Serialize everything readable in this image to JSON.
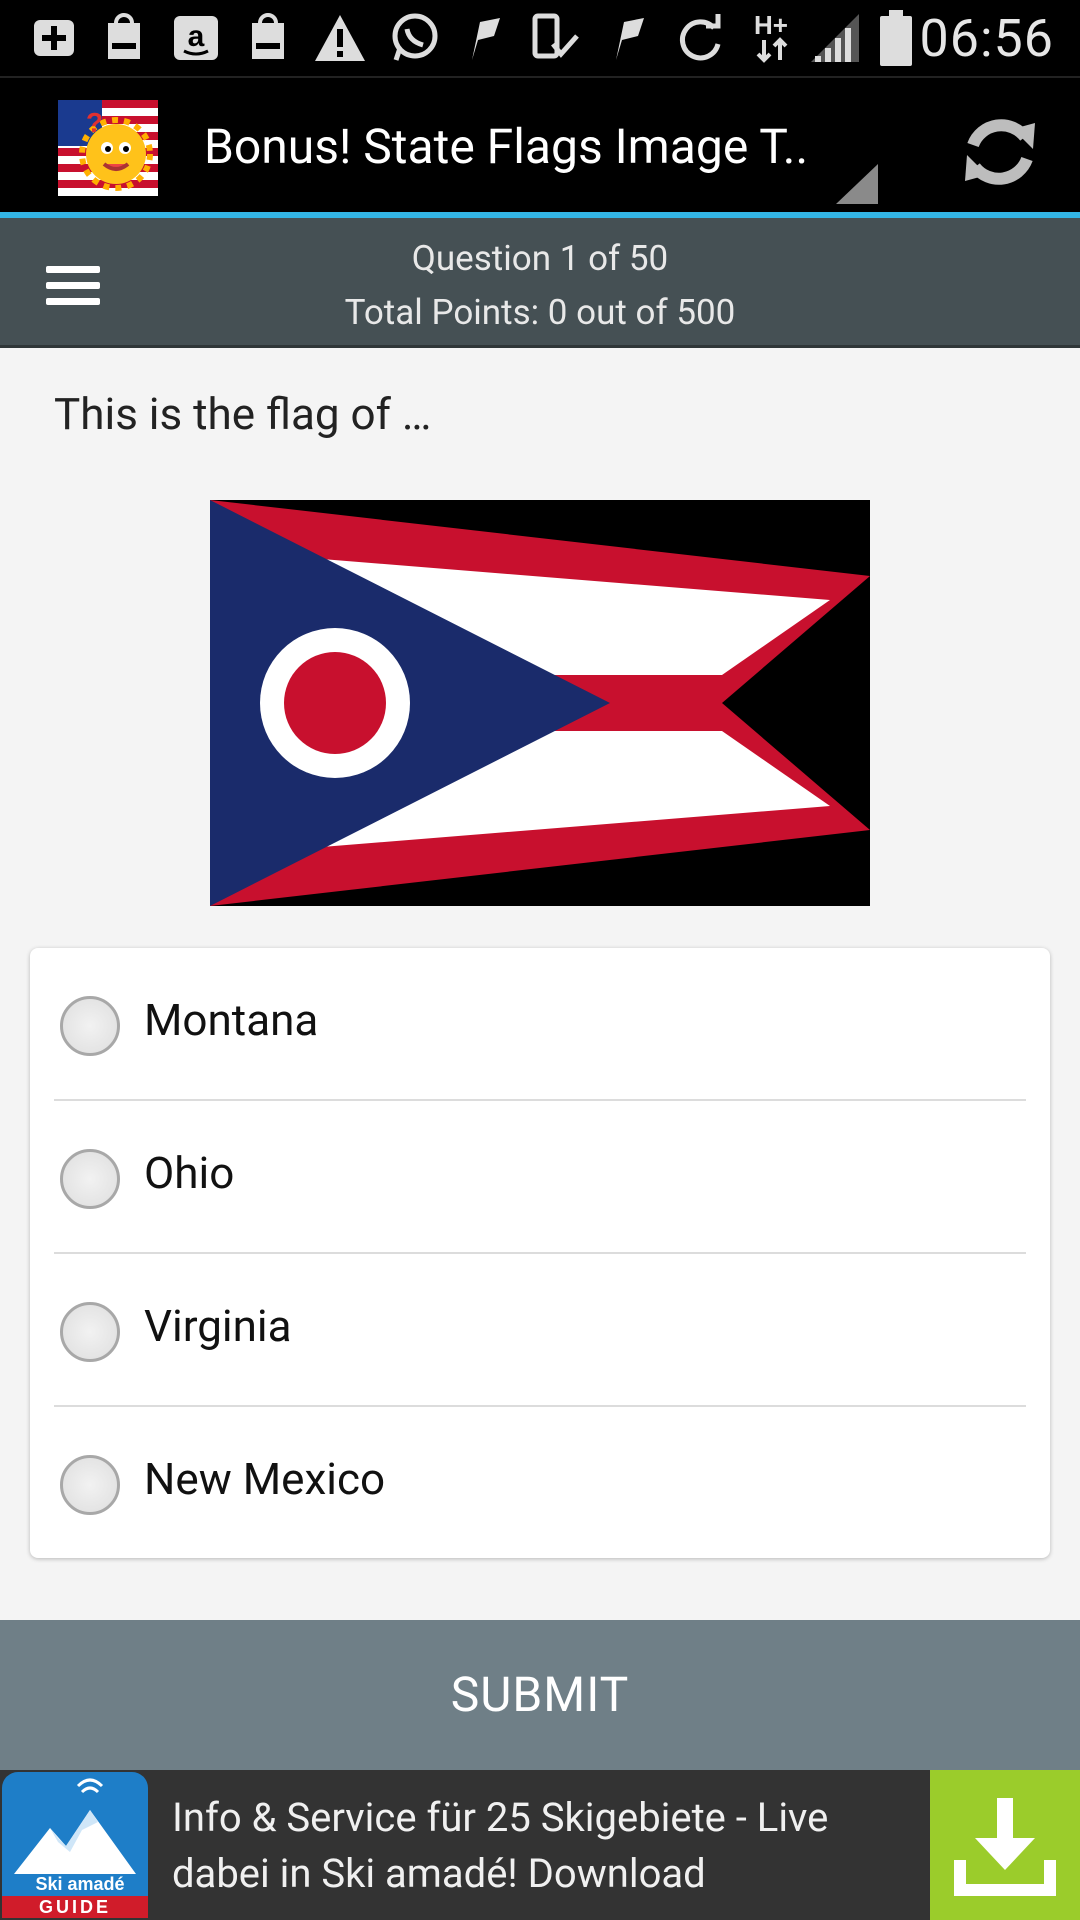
{
  "status_bar": {
    "time": "06:56",
    "icons": [
      "add-notification-icon",
      "galaxy-store-icon",
      "amazon-icon",
      "galaxy-store-icon",
      "warning-icon",
      "whatsapp-icon",
      "flag-icon",
      "download-done-icon",
      "flag-icon",
      "sync-icon",
      "hplus-data-icon",
      "signal-icon",
      "battery-icon"
    ]
  },
  "action_bar": {
    "title": "Bonus! State Flags Image T..",
    "logo_icon": "sun-flag-logo-icon",
    "refresh_icon": "refresh-icon"
  },
  "quiz_header": {
    "question_progress": "Question 1 of 50",
    "total_points": "Total Points: 0 out of 500",
    "menu_icon": "hamburger-menu-icon"
  },
  "question": {
    "prompt": "This is the flag of …",
    "image_icon": "ohio-flag-image"
  },
  "options": [
    {
      "label": "Montana",
      "selected": false
    },
    {
      "label": "Ohio",
      "selected": false
    },
    {
      "label": "Virginia",
      "selected": false
    },
    {
      "label": "New Mexico",
      "selected": false
    }
  ],
  "submit": {
    "label": "SUBMIT"
  },
  "ad": {
    "text": "Info & Service für 25 Skigebiete - Live dabei in Ski amadé! Download",
    "logo_text_top": "Ski amadé",
    "logo_text_bottom": "GUIDE",
    "download_icon": "download-icon"
  },
  "colors": {
    "accent": "#33b5e5",
    "header_bg": "#455054",
    "submit_bg": "#6f7f87",
    "ad_download_bg": "#9bcc2b"
  }
}
